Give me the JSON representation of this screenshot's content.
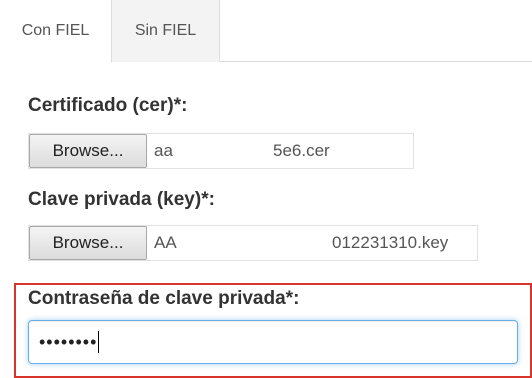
{
  "tabs": [
    {
      "label": "Con FIEL",
      "active": true
    },
    {
      "label": "Sin FIEL",
      "active": false
    }
  ],
  "certificate": {
    "label": "Certificado (cer)*:",
    "browse_label": "Browse...",
    "file_prefix": "aa",
    "file_suffix": "5e6.cer"
  },
  "private_key": {
    "label": "Clave privada (key)*:",
    "browse_label": "Browse...",
    "file_prefix": "AA",
    "file_suffix": "012231310.key"
  },
  "password": {
    "label": "Contraseña de clave privada*:",
    "masked_value": "••••••••"
  },
  "colors": {
    "highlight_border": "#d9342b",
    "focus_border": "#66afe9",
    "tab_border": "#dddddd"
  }
}
